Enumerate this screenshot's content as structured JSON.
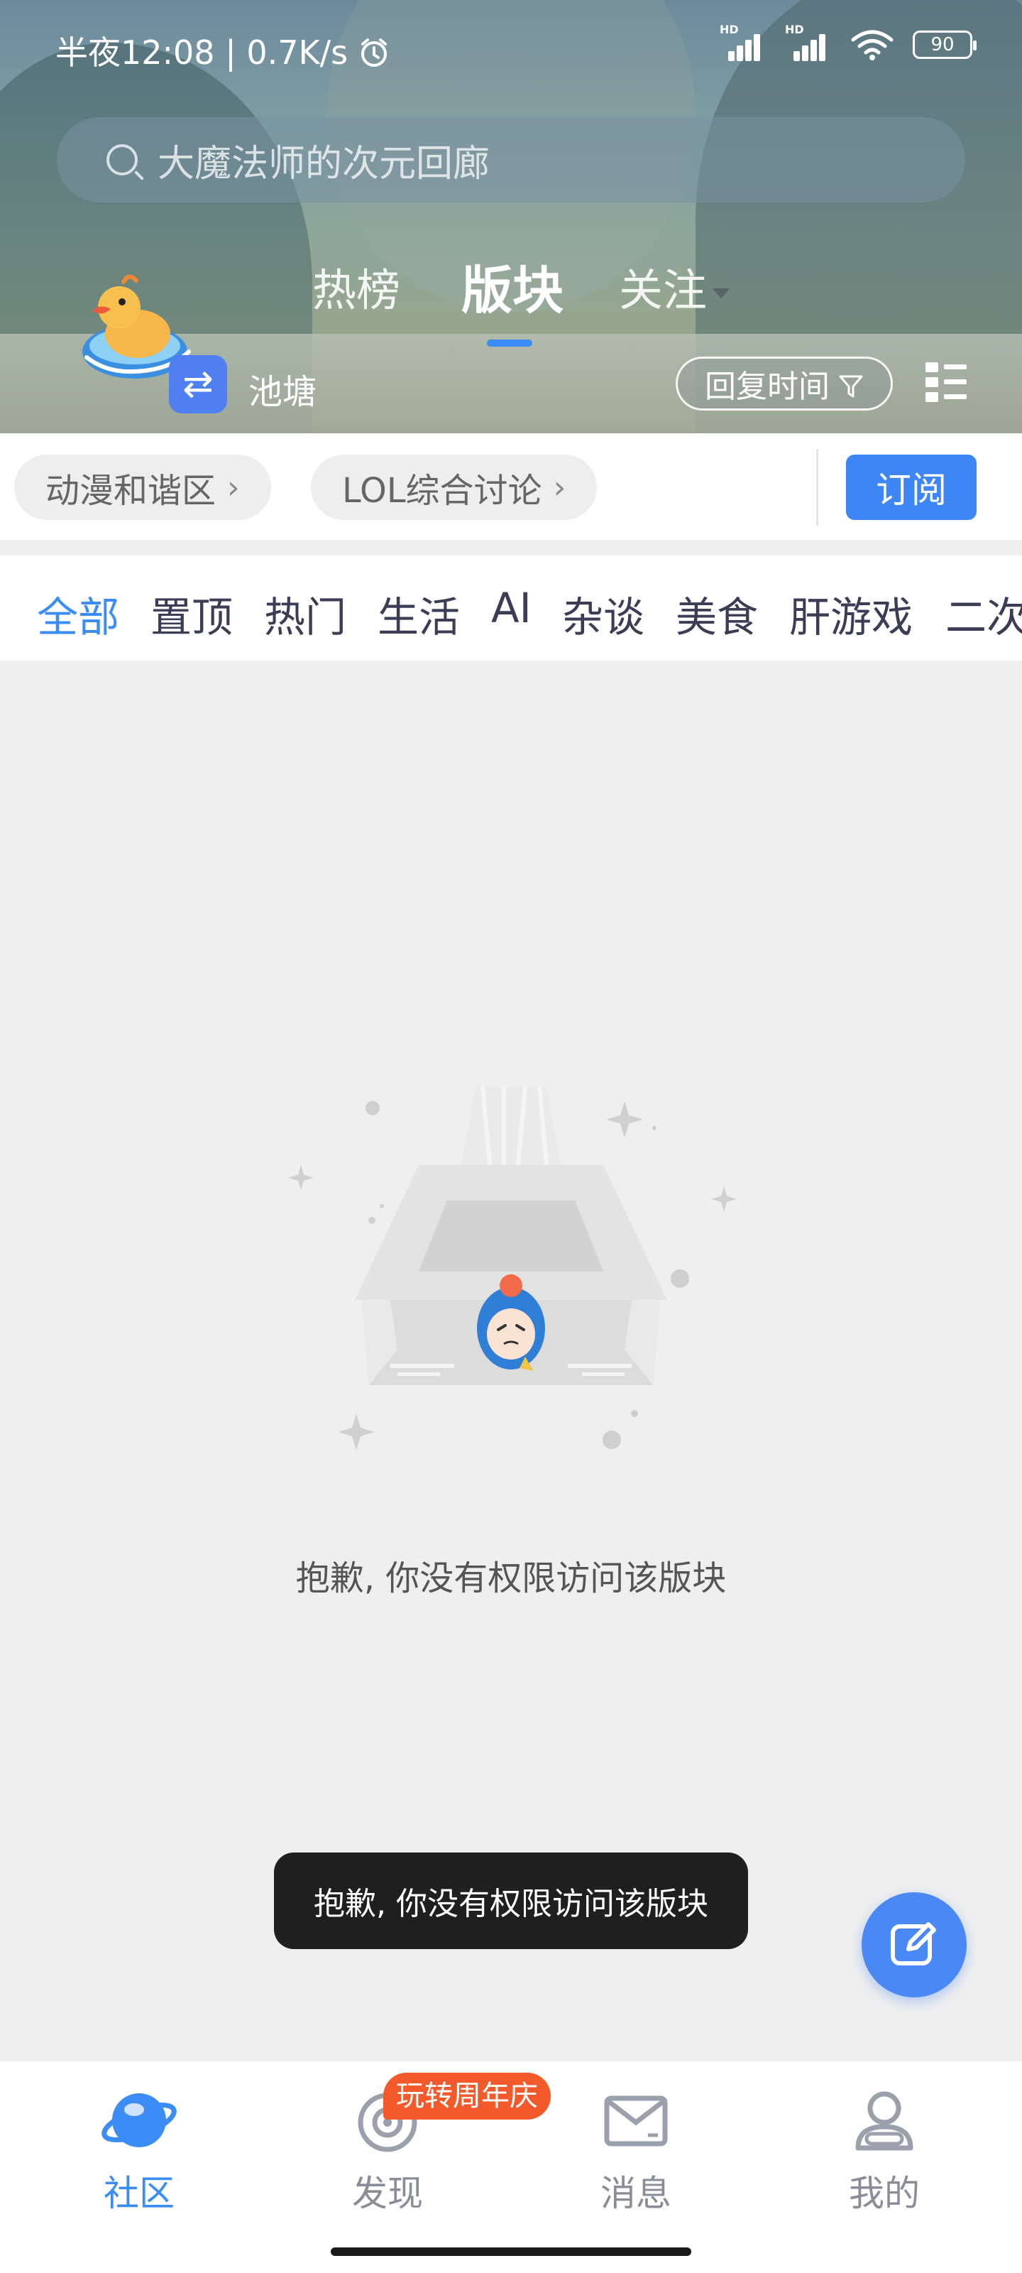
{
  "status_bar": {
    "time": "半夜12:08",
    "speed": "0.7K/s",
    "battery": "90",
    "sig_label": "HD"
  },
  "search": {
    "placeholder": "大魔法师的次元回廊"
  },
  "tabs": [
    {
      "label": "热榜"
    },
    {
      "label": "版块"
    },
    {
      "label": "关注"
    }
  ],
  "section": {
    "name": "池塘"
  },
  "sort": {
    "label": "回复时间"
  },
  "quick_links": [
    {
      "label": "动漫和谐区"
    },
    {
      "label": "LOL综合讨论"
    }
  ],
  "subscribe_label": "订阅",
  "categories": [
    "全部",
    "置顶",
    "热门",
    "生活",
    "AI",
    "杂谈",
    "美食",
    "肝游戏",
    "二次"
  ],
  "empty_message": "抱歉, 你没有权限访问该版块",
  "toast_message": "抱歉, 你没有权限访问该版块",
  "bottom_nav": [
    {
      "label": "社区"
    },
    {
      "label": "发现"
    },
    {
      "label": "消息"
    },
    {
      "label": "我的"
    }
  ],
  "nav_badge": "玩转周年庆",
  "colors": {
    "accent": "#3b8cf5",
    "badge": "#f35a2b",
    "toast_bg": "#1f1f1f"
  }
}
